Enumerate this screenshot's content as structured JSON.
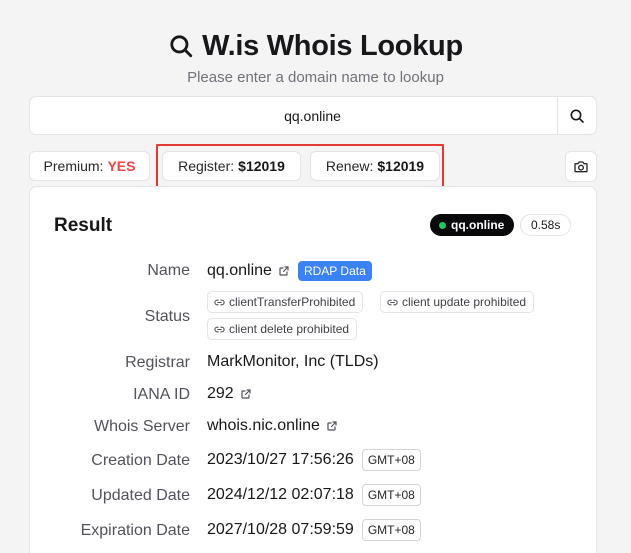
{
  "header": {
    "title": "W.is Whois Lookup",
    "subtitle": "Please enter a domain name to lookup",
    "icon": "search-icon"
  },
  "search": {
    "value": "qq.online",
    "button_icon": "search-icon"
  },
  "pricing": {
    "premium_label": "Premium:",
    "premium_value": "YES",
    "register_label": "Register:",
    "register_value": "$12019",
    "renew_label": "Renew:",
    "renew_value": "$12019",
    "highlight_color": "#e53935"
  },
  "screenshot_button_icon": "camera-icon",
  "result": {
    "title": "Result",
    "domain_badge": "qq.online",
    "time_badge": "0.58s",
    "rows": {
      "name_label": "Name",
      "name_value": "qq.online",
      "rdap_label": "RDAP Data",
      "status_label": "Status",
      "status_values": [
        "clientTransferProhibited",
        "client update prohibited",
        "client delete prohibited"
      ],
      "registrar_label": "Registrar",
      "registrar_value": "MarkMonitor, Inc (TLDs)",
      "iana_label": "IANA ID",
      "iana_value": "292",
      "whois_label": "Whois Server",
      "whois_value": "whois.nic.online",
      "creation_label": "Creation Date",
      "creation_value": "2023/10/27 17:56:26",
      "updated_label": "Updated Date",
      "updated_value": "2024/12/12 02:07:18",
      "expiration_label": "Expiration Date",
      "expiration_value": "2027/10/28 07:59:59",
      "timezone": "GMT+08"
    }
  },
  "colors": {
    "accent_blue": "#3b82f6",
    "premium_red": "#ef4444",
    "status_green": "#22c55e"
  }
}
